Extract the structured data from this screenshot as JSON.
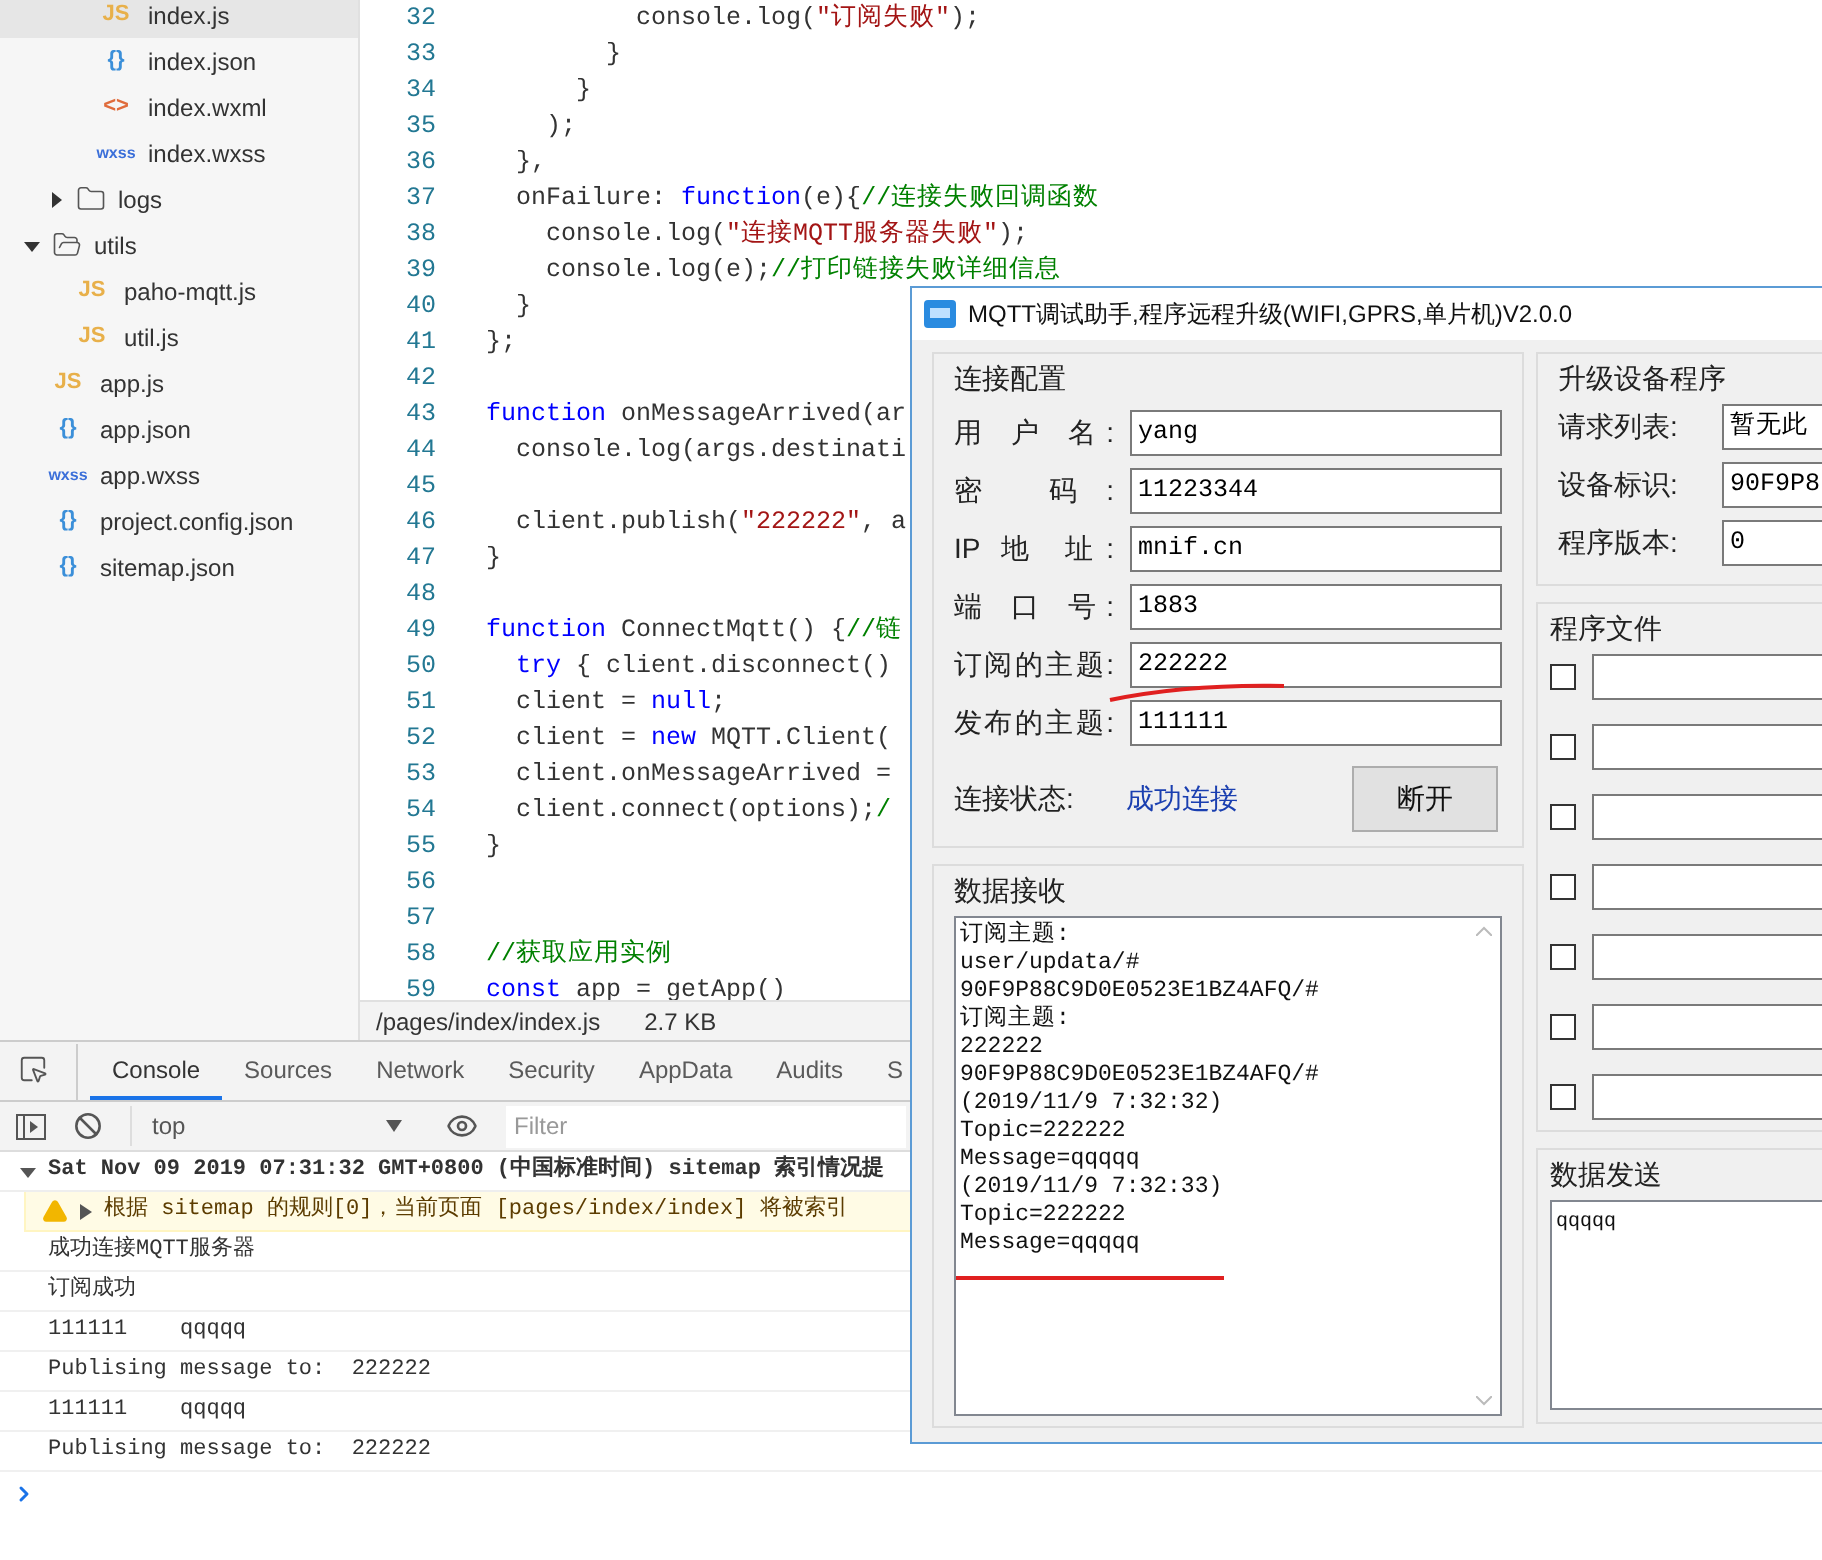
{
  "file_tree": [
    {
      "children": [
        {
          "children": [
            {
              "name": "index.js",
              "kind": "file",
              "badge": "JS",
              "color": "#e8b04a",
              "selected": true
            },
            {
              "name": "index.json",
              "kind": "file",
              "badge": "{}",
              "color": "#3b8fd9",
              "selected": false
            },
            {
              "name": "index.wxml",
              "kind": "file",
              "badge": "<>",
              "color": "#e06c3c",
              "selected": false
            },
            {
              "name": "index.wxss",
              "kind": "file",
              "badge": "wxss",
              "color": "#3b6fd9",
              "selected": false
            }
          ]
        },
        {
          "name": "logs",
          "kind": "folder",
          "expanded": false,
          "selected": false
        }
      ]
    },
    {
      "name": "utils",
      "kind": "folder",
      "expanded": true,
      "selected": false,
      "children": [
        {
          "name": "paho-mqtt.js",
          "kind": "file",
          "badge": "JS",
          "color": "#e8b04a",
          "selected": false
        },
        {
          "name": "util.js",
          "kind": "file",
          "badge": "JS",
          "color": "#e8b04a",
          "selected": false
        }
      ]
    },
    {
      "name": "app.js",
      "kind": "file",
      "badge": "JS",
      "color": "#e8b04a",
      "selected": false
    },
    {
      "name": "app.json",
      "kind": "file",
      "badge": "{}",
      "color": "#3b8fd9",
      "selected": false
    },
    {
      "name": "app.wxss",
      "kind": "file",
      "badge": "wxss",
      "color": "#3b6fd9",
      "selected": false
    },
    {
      "name": "project.config.json",
      "kind": "file",
      "badge": "{}",
      "color": "#3b8fd9",
      "selected": false
    },
    {
      "name": "sitemap.json",
      "kind": "file",
      "badge": "{}",
      "color": "#3b8fd9",
      "selected": false
    }
  ],
  "editor": {
    "lines": [
      {
        "number": "32",
        "tokens": [
          {
            "text": "          console.log(",
            "kind": "plain"
          },
          {
            "text": "\"订阅失败\"",
            "kind": "string"
          },
          {
            "text": ");",
            "kind": "plain"
          }
        ]
      },
      {
        "number": "33",
        "tokens": [
          {
            "text": "        }",
            "kind": "plain"
          }
        ]
      },
      {
        "number": "34",
        "tokens": [
          {
            "text": "      }",
            "kind": "plain"
          }
        ]
      },
      {
        "number": "35",
        "tokens": [
          {
            "text": "    );",
            "kind": "plain"
          }
        ]
      },
      {
        "number": "36",
        "tokens": [
          {
            "text": "  },",
            "kind": "plain"
          }
        ]
      },
      {
        "number": "37",
        "tokens": [
          {
            "text": "  onFailure: ",
            "kind": "plain"
          },
          {
            "text": "function",
            "kind": "keyword"
          },
          {
            "text": "(e){",
            "kind": "plain"
          },
          {
            "text": "//连接失败回调函数",
            "kind": "comment"
          }
        ]
      },
      {
        "number": "38",
        "tokens": [
          {
            "text": "    console.log(",
            "kind": "plain"
          },
          {
            "text": "\"连接MQTT服务器失败\"",
            "kind": "string"
          },
          {
            "text": ");",
            "kind": "plain"
          }
        ]
      },
      {
        "number": "39",
        "tokens": [
          {
            "text": "    console.log(e);",
            "kind": "plain"
          },
          {
            "text": "//打印链接失败详细信息",
            "kind": "comment"
          }
        ]
      },
      {
        "number": "40",
        "tokens": [
          {
            "text": "  }",
            "kind": "plain"
          }
        ]
      },
      {
        "number": "41",
        "tokens": [
          {
            "text": "};",
            "kind": "plain"
          }
        ]
      },
      {
        "number": "42"
      },
      {
        "number": "43",
        "tokens": [
          {
            "text": "function",
            "kind": "keyword"
          },
          {
            "text": " onMessageArrived(ar",
            "kind": "plain"
          }
        ]
      },
      {
        "number": "44",
        "tokens": [
          {
            "text": "  console.log(args.destinati",
            "kind": "plain"
          }
        ]
      },
      {
        "number": "45"
      },
      {
        "number": "46",
        "tokens": [
          {
            "text": "  client.publish(",
            "kind": "plain"
          },
          {
            "text": "\"222222\"",
            "kind": "string"
          },
          {
            "text": ", a",
            "kind": "plain"
          }
        ]
      },
      {
        "number": "47",
        "tokens": [
          {
            "text": "}",
            "kind": "plain"
          }
        ]
      },
      {
        "number": "48"
      },
      {
        "number": "49",
        "tokens": [
          {
            "text": "function",
            "kind": "keyword"
          },
          {
            "text": " ConnectMqtt() {",
            "kind": "plain"
          },
          {
            "text": "//链",
            "kind": "comment"
          }
        ]
      },
      {
        "number": "50",
        "tokens": [
          {
            "text": "  try",
            "kind": "keyword"
          },
          {
            "text": " { client.disconnect()",
            "kind": "plain"
          }
        ]
      },
      {
        "number": "51",
        "tokens": [
          {
            "text": "  client = ",
            "kind": "plain"
          },
          {
            "text": "null",
            "kind": "keyword"
          },
          {
            "text": ";",
            "kind": "plain"
          }
        ]
      },
      {
        "number": "52",
        "tokens": [
          {
            "text": "  client = ",
            "kind": "plain"
          },
          {
            "text": "new",
            "kind": "keyword"
          },
          {
            "text": " MQTT.Client(",
            "kind": "plain"
          }
        ]
      },
      {
        "number": "53",
        "tokens": [
          {
            "text": "  client.onMessageArrived =",
            "kind": "plain"
          }
        ]
      },
      {
        "number": "54",
        "tokens": [
          {
            "text": "  client.connect(options);",
            "kind": "plain"
          },
          {
            "text": "/",
            "kind": "comment"
          }
        ]
      },
      {
        "number": "55",
        "tokens": [
          {
            "text": "}",
            "kind": "plain"
          }
        ]
      },
      {
        "number": "56"
      },
      {
        "number": "57"
      },
      {
        "number": "58",
        "tokens": [
          {
            "text": "//获取应用实例",
            "kind": "comment"
          }
        ]
      },
      {
        "number": "59",
        "tokens": [
          {
            "text": "const",
            "kind": "keyword"
          },
          {
            "text": " app = getApp()",
            "kind": "plain"
          }
        ]
      }
    ],
    "status": {
      "path": "/pages/index/index.js",
      "size": "2.7 KB"
    }
  },
  "devtools": {
    "tabs": [
      {
        "label": "Console",
        "selected": true
      },
      {
        "label": "Sources",
        "selected": false
      },
      {
        "label": "Network",
        "selected": false
      },
      {
        "label": "Security",
        "selected": false
      },
      {
        "label": "AppData",
        "selected": false
      },
      {
        "label": "Audits",
        "selected": false
      },
      {
        "label": "S",
        "selected": false
      }
    ],
    "context": "top",
    "filter_placeholder": "Filter",
    "group": {
      "expanded": true,
      "text": "Sat Nov 09 2019 07:31:32 GMT+0800 (中国标准时间) sitemap 索引情况提"
    },
    "warning": "根据 sitemap 的规则[0]，当前页面 [pages/index/index] 将被索引",
    "logs": [
      "成功连接MQTT服务器",
      "订阅成功",
      "111111    qqqqq",
      "Publising message to:  222222",
      "111111    qqqqq",
      "Publising message to:  222222"
    ]
  },
  "dialog": {
    "title": "MQTT调试助手,程序远程升级(WIFI,GPRS,单片机)V2.0.0",
    "connection": {
      "title": "连接配置",
      "fields": [
        {
          "label": "用 户 名:",
          "value": "yang"
        },
        {
          "label": "密 码:",
          "value": "11223344"
        },
        {
          "label": "IP 地 址:",
          "value": "mnif.cn"
        },
        {
          "label": "端 口 号:",
          "value": "1883"
        },
        {
          "label": "订阅的主题:",
          "value": "222222"
        },
        {
          "label": "发布的主题:",
          "value": "111111"
        }
      ],
      "status_label": "连接状态:",
      "status_value": "成功连接",
      "button": "断开"
    },
    "receive": {
      "title": "数据接收",
      "lines": [
        "订阅主题:",
        "user/updata/#",
        "90F9P88C9D0E0523E1BZ4AFQ/#",
        "订阅主题:",
        "222222",
        "90F9P88C9D0E0523E1BZ4AFQ/#",
        "(2019/11/9 7:32:32)",
        "Topic=222222",
        "Message=qqqqq",
        "(2019/11/9 7:32:33)",
        "Topic=222222",
        "Message=qqqqq"
      ]
    },
    "upgrade": {
      "title": "升级设备程序",
      "fields": [
        {
          "label": "请求列表:",
          "value": "暂无此"
        },
        {
          "label": "设备标识:",
          "value": "90F9P8"
        },
        {
          "label": "程序版本:",
          "value": "0"
        }
      ]
    },
    "files": {
      "title": "程序文件",
      "rows": [
        {
          "checked": false
        },
        {
          "checked": false
        },
        {
          "checked": false
        },
        {
          "checked": false
        },
        {
          "checked": false
        },
        {
          "checked": false
        },
        {
          "checked": false
        }
      ]
    },
    "send": {
      "title": "数据发送",
      "value": "qqqqq"
    }
  }
}
